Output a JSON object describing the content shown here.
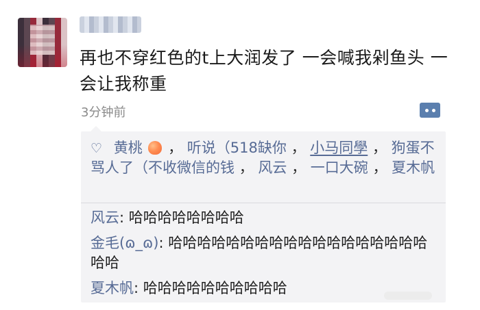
{
  "post": {
    "text": "再也不穿红色的t上大润发了 一会喊我剁鱼头 一会让我称重",
    "timestamp": "3分钟前"
  },
  "likes": {
    "names": [
      "黄桃",
      "听说（518缺你",
      "小马同學",
      "狗蛋不骂人了（不收微信的钱",
      "风云",
      "一口大碗",
      "夏木帆"
    ],
    "icon": "heart-outline-icon",
    "peach_icon": "peach-emoji-icon",
    "separator": "，"
  },
  "comments": [
    {
      "author": "风云",
      "text": "哈哈哈哈哈哈哈哈"
    },
    {
      "author": "金毛(ɷ_ɷ)",
      "text": "哈哈哈哈哈哈哈哈哈哈哈哈哈哈哈哈哈哈哈哈"
    },
    {
      "author": "夏木帆",
      "text": "哈哈哈哈哈哈哈哈哈哈"
    }
  ],
  "colors": {
    "link": "#576b95",
    "panel": "#f3f3f5",
    "timestamp": "#8a8a8a",
    "button": "#5b7fae"
  }
}
